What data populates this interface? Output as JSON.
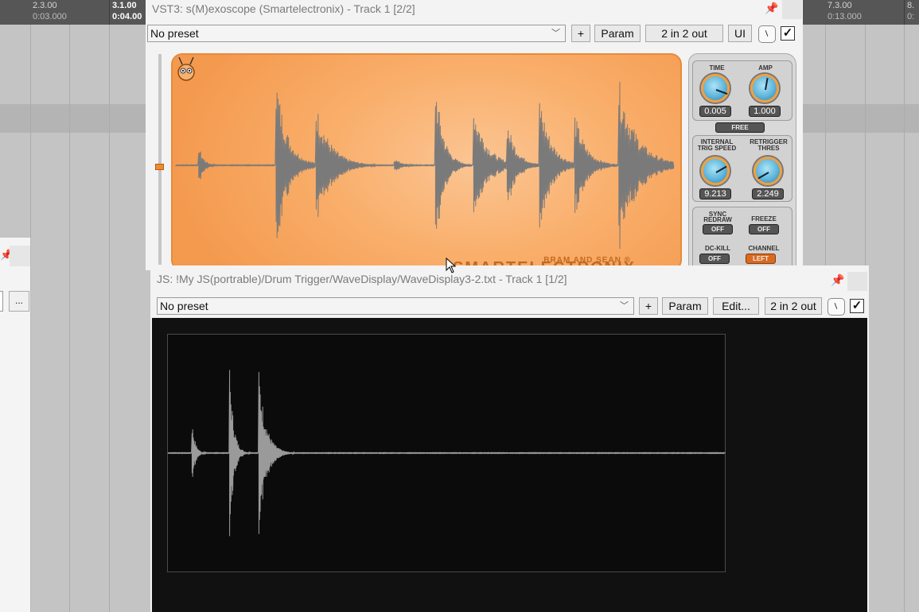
{
  "timeline": {
    "markers": [
      {
        "top": "2.3.00",
        "bottom": "0:03.000",
        "bold": false
      },
      {
        "top": "3.1.00",
        "bottom": "0:04.00",
        "bold": true
      },
      {
        "top": "7.3.00",
        "bottom": "0:13.000",
        "bold": false
      },
      {
        "top": "8.",
        "bottom": "0:",
        "bold": false
      }
    ]
  },
  "left_window": {
    "dots_label": "..."
  },
  "vst_window": {
    "title": "VST3: s(M)exoscope (Smartelectronix) - Track 1 [2/2]",
    "preset": "No preset",
    "add_label": "+",
    "param_label": "Param",
    "io_label": "2 in 2 out",
    "ui_label": "UI",
    "enabled_mark": "✓",
    "plugin": {
      "brand_line1": "BRAM AND SEAN ®",
      "brand_line2": "SMARTELECTRONIX",
      "controls": {
        "time": {
          "label": "TIME",
          "value": "0.005"
        },
        "amp": {
          "label": "AMP",
          "value": "1.000"
        },
        "free_label": "FREE",
        "internal": {
          "label1": "INTERNAL",
          "label2": "TRIG SPEED",
          "value": "9.213"
        },
        "retrigger": {
          "label1": "RETRIGGER",
          "label2": "THRES",
          "value": "2.249"
        },
        "sync": {
          "label1": "SYNC",
          "label2": "REDRAW",
          "value": "OFF"
        },
        "freeze": {
          "label": "FREEZE",
          "value": "OFF"
        },
        "dckill": {
          "label": "DC-KILL",
          "value": "OFF"
        },
        "channel": {
          "label": "CHANNEL",
          "value": "LEFT"
        }
      }
    }
  },
  "js_window": {
    "title": "JS: !My JS(portrable)/Drum Trigger/WaveDisplay/WaveDisplay3-2.txt - Track 1 [1/2]",
    "preset": "No preset",
    "add_label": "+",
    "param_label": "Param",
    "edit_label": "Edit...",
    "io_label": "2 in 2 out",
    "enabled_mark": "✓"
  },
  "colors": {
    "scope_orange": "#f9ae6a",
    "scope_wave": "#7a7a7a",
    "js_wave": "#9a9a9a",
    "knob_blue": "#5fb6dc"
  }
}
